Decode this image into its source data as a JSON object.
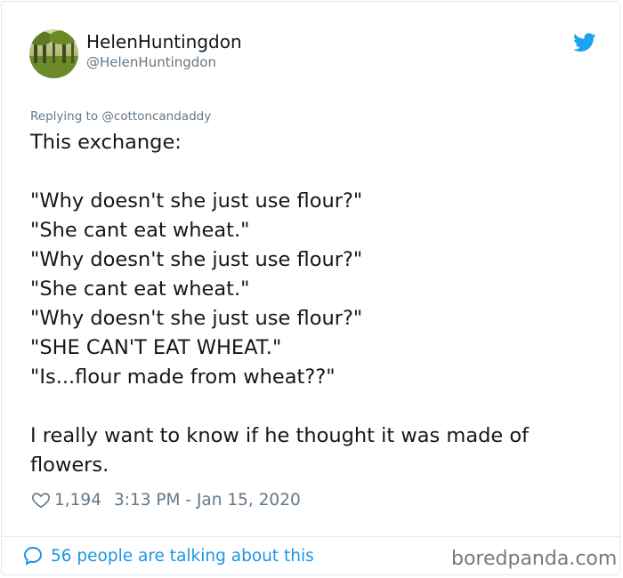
{
  "tweet": {
    "display_name": "HelenHuntingdon",
    "handle": "@HelenHuntingdon",
    "replying_to": "Replying to @cottoncandaddy",
    "lines": [
      "This exchange:",
      "",
      "\"Why doesn't she just use flour?\"",
      "\"She cant eat wheat.\"",
      "\"Why doesn't she just use flour?\"",
      "\"She cant eat wheat.\"",
      "\"Why doesn't she just use flour?\"",
      "\"SHE CAN'T EAT WHEAT.\"",
      "\"Is...flour made from wheat??\"",
      "",
      "I really want to know if he thought it was made of",
      "flowers."
    ],
    "likes": "1,194",
    "timestamp": "3:13 PM - Jan 15, 2020",
    "talking": "56 people are talking about this"
  },
  "watermark": "boredpanda.com",
  "icons": {
    "bird": "twitter-bird-icon",
    "heart": "heart-icon",
    "bubble": "speech-bubble-icon"
  },
  "colors": {
    "twitter_blue": "#1da1f2",
    "link_blue": "#1b95e0",
    "muted": "#657786",
    "text": "#14171a",
    "border": "#e1e8ed"
  }
}
